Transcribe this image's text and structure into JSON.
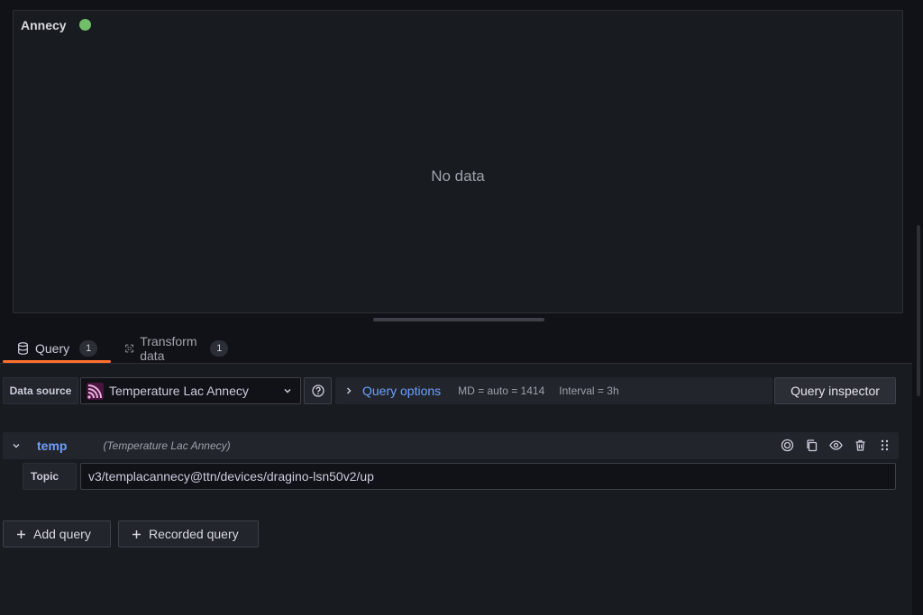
{
  "panel": {
    "title": "Annecy",
    "status_color": "#73bf69",
    "empty_text": "No data"
  },
  "tabs": [
    {
      "label": "Query",
      "count": "1",
      "icon": "database-icon",
      "active": true
    },
    {
      "label": "Transform data",
      "count": "1",
      "icon": "transform-icon",
      "active": false
    }
  ],
  "datasource": {
    "label": "Data source",
    "selected": "Temperature Lac Annecy",
    "icon": "wireless-signal-icon"
  },
  "query_options": {
    "label": "Query options",
    "md": "MD = auto = 1414",
    "interval": "Interval = 3h"
  },
  "query_inspector": {
    "label": "Query inspector"
  },
  "query": {
    "ref": "temp",
    "datasource_hint": "(Temperature Lac Annecy)",
    "topic_label": "Topic",
    "topic_value": "v3/templacannecy@ttn/devices/dragino-lsn50v2/up"
  },
  "actions": {
    "add_query": "Add query",
    "recorded_query": "Recorded query"
  },
  "colors": {
    "accent_blue": "#6e9fff",
    "tab_underline": "#ff6f2e"
  }
}
